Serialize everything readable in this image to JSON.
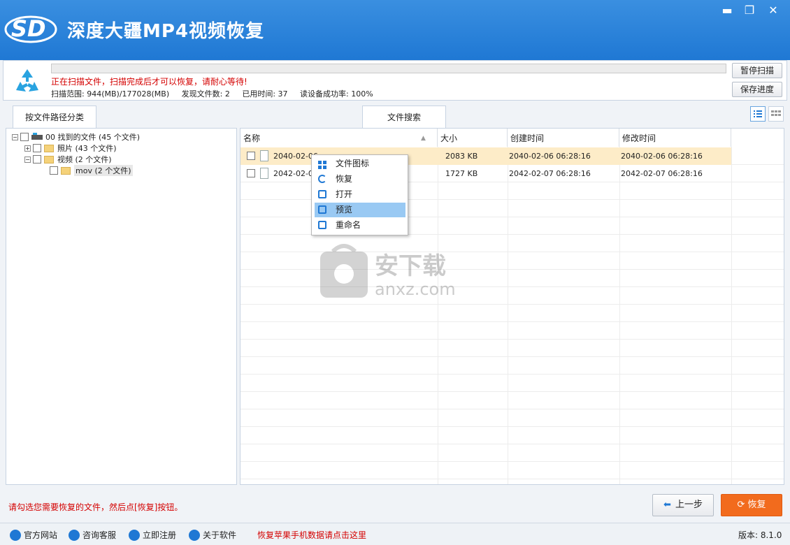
{
  "window": {
    "title": "深度大疆MP4视频恢复",
    "logo_text": "SD",
    "minimize_glyph": "▬",
    "restore_glyph": "❐",
    "close_glyph": "✕"
  },
  "scan": {
    "progress": 0,
    "message": "正在扫描文件，扫描完成后才可以恢复，请耐心等待!",
    "range": "扫描范围: 944(MB)/177028(MB)",
    "found": "发现文件数: 2",
    "elapsed": "已用时间: 37",
    "read_rate": "读设备成功率: 100%",
    "pause_label": "暂停扫描",
    "save_label": "保存进度"
  },
  "tabs": {
    "path_label": "按文件路径分类",
    "search_label": "文件搜索"
  },
  "tree": [
    {
      "expander": "−",
      "label": "00 找到的文件  (45 个文件)"
    },
    {
      "expander": "+",
      "label": "照片    (43 个文件)"
    },
    {
      "expander": "−",
      "label": "视频    (2 个文件)"
    },
    {
      "expander": "",
      "label": "mov    (2 个文件)"
    }
  ],
  "list": {
    "headers": {
      "name": "名称",
      "size": "大小",
      "created": "创建时间",
      "modified": "修改时间"
    },
    "rows": [
      {
        "name": "2040-02-06",
        "size": "2083 KB",
        "created": "2040-02-06  06:28:16",
        "modified": "2040-02-06  06:28:16"
      },
      {
        "name": "2042-02-07",
        "size": "1727 KB",
        "created": "2042-02-07  06:28:16",
        "modified": "2042-02-07  06:28:16"
      }
    ]
  },
  "context_menu": [
    {
      "label": "文件图标",
      "icon": "grid-icon"
    },
    {
      "label": "恢复",
      "icon": "refresh-icon"
    },
    {
      "label": "打开",
      "icon": "open-icon"
    },
    {
      "label": "预览",
      "icon": "preview-icon"
    },
    {
      "label": "重命名",
      "icon": "rename-icon"
    }
  ],
  "watermark": {
    "text1": "安下载",
    "text2": "anxz.com"
  },
  "footer": {
    "hint": "请勾选您需要恢复的文件，然后点[恢复]按钮。",
    "back_label": "上一步",
    "recover_label": "恢复"
  },
  "status": {
    "website": "官方网站",
    "support": "咨询客服",
    "register": "立即注册",
    "about": "关于软件",
    "promo": "恢复苹果手机数据请点击这里",
    "version": "版本: 8.1.0"
  },
  "colors": {
    "title_blue": "#1f78d4",
    "accent_orange": "#f26b1d",
    "warning_red": "#d40000",
    "selected_row": "#fdecc8",
    "menu_highlight": "#99c9f3"
  }
}
